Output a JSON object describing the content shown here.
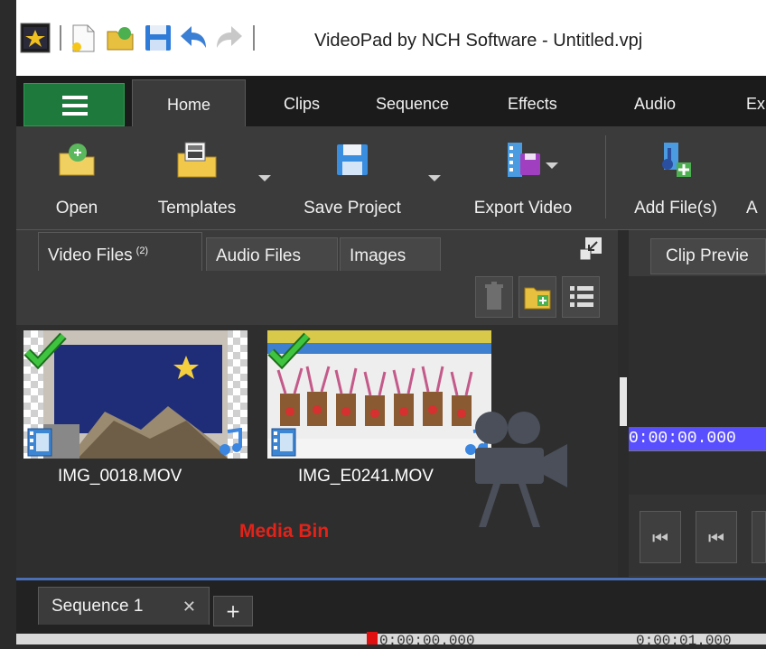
{
  "window": {
    "title": "VideoPad by NCH Software - Untitled.vpj"
  },
  "ribbon_tabs": [
    {
      "label": "Home",
      "active": true
    },
    {
      "label": "Clips"
    },
    {
      "label": "Sequence"
    },
    {
      "label": "Effects"
    },
    {
      "label": "Audio"
    },
    {
      "label": "Ex"
    }
  ],
  "toolbar": {
    "open": "Open",
    "templates": "Templates",
    "save_project": "Save Project",
    "export_video": "Export Video",
    "add_files": "Add File(s)",
    "next_partial": "A"
  },
  "media_panel": {
    "tabs": [
      {
        "label": "Video Files",
        "badge": "(2)",
        "active": true
      },
      {
        "label": "Audio Files"
      },
      {
        "label": "Images"
      }
    ],
    "files": [
      {
        "name": "IMG_0018.MOV",
        "checked": true,
        "has_audio": true
      },
      {
        "name": "IMG_E0241.MOV",
        "checked": true,
        "has_audio": true
      }
    ],
    "annotation": "Media Bin"
  },
  "preview": {
    "tab": "Clip Previe",
    "timecode": "0:00:00.000"
  },
  "sequence": {
    "tab": "Sequence 1",
    "close_glyph": "✕",
    "add_glyph": "+",
    "ruler_times": [
      "0:00:00.000",
      "0:00:01.000"
    ]
  },
  "colors": {
    "menu_button": "#1e7a3c",
    "ribbon_bg": "#1b1b1b",
    "panel_bg": "#3b3b3b",
    "annotation": "#e2231a",
    "timecode_bg": "#5a4fff",
    "playhead": "#e01010"
  }
}
